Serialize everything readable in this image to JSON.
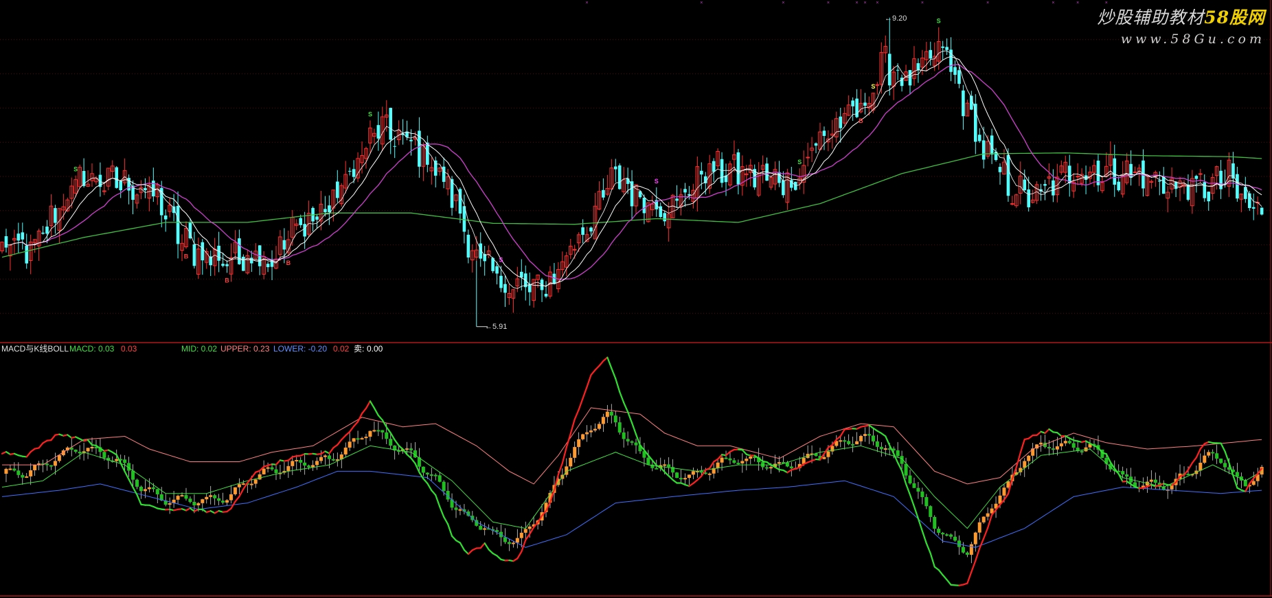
{
  "watermark": {
    "title_a": "炒股辅助教材",
    "title_b": "58股网",
    "url": "www.58Gu.com"
  },
  "indicator": {
    "name": "MACD与K线BOLL",
    "macd_label": "MACD: 0.03",
    "macd_value2": "0.03",
    "mid_label": "MID: 0.02",
    "upper_label": "UPPER: 0.23",
    "lower_label": "LOWER: -0.20",
    "value4": "0.02",
    "sell_label": "卖:",
    "sell_value": "0.00"
  },
  "price_labels": {
    "high": "9.20",
    "low": "5.91"
  },
  "colors": {
    "background": "#000000",
    "up_candle": "#ff3030",
    "down_candle": "#54ffff",
    "ma5": "#ffffff",
    "ma10": "#ffffff",
    "ma20": "#d040d0",
    "ma60": "#40c040",
    "upper_band": "#ff8080",
    "lower_band": "#4070ff",
    "mid_band": "#40e040",
    "macd_line_up": "#ff2020",
    "macd_line_down": "#30e030",
    "bar_up": "#ff9a30",
    "bar_down": "#20c020",
    "divider": "#b01818"
  },
  "markers": {
    "buy": "B",
    "sell": "S"
  },
  "chart_data": [
    {
      "type": "candlestick",
      "panel": "price",
      "price_high": 9.2,
      "price_low": 5.91,
      "anchors": [
        [
          0,
          6.76
        ],
        [
          8,
          6.72
        ],
        [
          14,
          7.2
        ],
        [
          20,
          7.5
        ],
        [
          26,
          7.45
        ],
        [
          32,
          7.42
        ],
        [
          38,
          7.28
        ],
        [
          44,
          6.82
        ],
        [
          50,
          6.66
        ],
        [
          56,
          6.62
        ],
        [
          62,
          6.72
        ],
        [
          66,
          6.62
        ],
        [
          72,
          6.96
        ],
        [
          80,
          7.18
        ],
        [
          86,
          7.6
        ],
        [
          92,
          8.02
        ],
        [
          98,
          7.9
        ],
        [
          104,
          7.72
        ],
        [
          110,
          7.32
        ],
        [
          116,
          6.62
        ],
        [
          122,
          6.38
        ],
        [
          128,
          6.32
        ],
        [
          132,
          6.3
        ],
        [
          136,
          6.52
        ],
        [
          140,
          6.82
        ],
        [
          145,
          7.12
        ],
        [
          150,
          7.52
        ],
        [
          156,
          7.28
        ],
        [
          164,
          7.18
        ],
        [
          172,
          7.58
        ],
        [
          180,
          7.56
        ],
        [
          188,
          7.48
        ],
        [
          194,
          7.48
        ],
        [
          200,
          7.92
        ],
        [
          210,
          8.22
        ],
        [
          216,
          8.72
        ],
        [
          222,
          8.52
        ],
        [
          230,
          8.88
        ],
        [
          234,
          8.42
        ],
        [
          240,
          7.78
        ],
        [
          246,
          7.42
        ],
        [
          252,
          7.26
        ],
        [
          256,
          7.38
        ],
        [
          262,
          7.6
        ],
        [
          268,
          7.56
        ],
        [
          276,
          7.55
        ],
        [
          282,
          7.45
        ],
        [
          288,
          7.4
        ],
        [
          294,
          7.38
        ],
        [
          300,
          7.48
        ],
        [
          304,
          7.2
        ],
        [
          308,
          7.12
        ]
      ],
      "ma60_anchors": [
        [
          0,
          6.65
        ],
        [
          20,
          6.86
        ],
        [
          40,
          7.02
        ],
        [
          60,
          7.02
        ],
        [
          80,
          7.12
        ],
        [
          100,
          7.12
        ],
        [
          120,
          7.01
        ],
        [
          140,
          7.0
        ],
        [
          160,
          7.06
        ],
        [
          180,
          7.02
        ],
        [
          200,
          7.22
        ],
        [
          220,
          7.54
        ],
        [
          240,
          7.75
        ],
        [
          260,
          7.76
        ],
        [
          280,
          7.73
        ],
        [
          300,
          7.72
        ],
        [
          308,
          7.7
        ]
      ]
    },
    {
      "type": "line",
      "panel": "indicator",
      "value_range": [
        -0.38,
        0.36
      ],
      "series": [
        {
          "name": "MACD",
          "anchors": [
            [
              0,
              0.06
            ],
            [
              6,
              0.05
            ],
            [
              14,
              0.12
            ],
            [
              20,
              0.1
            ],
            [
              28,
              0.05
            ],
            [
              34,
              -0.1
            ],
            [
              40,
              -0.12
            ],
            [
              46,
              -0.12
            ],
            [
              52,
              -0.13
            ],
            [
              56,
              -0.12
            ],
            [
              62,
              0.0
            ],
            [
              68,
              0.03
            ],
            [
              74,
              0.05
            ],
            [
              80,
              0.06
            ],
            [
              86,
              0.14
            ],
            [
              90,
              0.22
            ],
            [
              96,
              0.1
            ],
            [
              100,
              0.04
            ],
            [
              106,
              -0.08
            ],
            [
              110,
              -0.2
            ],
            [
              114,
              -0.26
            ],
            [
              118,
              -0.23
            ],
            [
              122,
              -0.28
            ],
            [
              126,
              -0.28
            ],
            [
              128,
              -0.22
            ],
            [
              134,
              -0.1
            ],
            [
              140,
              0.16
            ],
            [
              144,
              0.3
            ],
            [
              148,
              0.36
            ],
            [
              152,
              0.22
            ],
            [
              156,
              0.08
            ],
            [
              160,
              0.02
            ],
            [
              164,
              -0.03
            ],
            [
              168,
              -0.05
            ],
            [
              172,
              0.0
            ],
            [
              176,
              0.05
            ],
            [
              180,
              0.07
            ],
            [
              188,
              0.02
            ],
            [
              192,
              0.0
            ],
            [
              196,
              0.02
            ],
            [
              200,
              0.04
            ],
            [
              206,
              0.13
            ],
            [
              212,
              0.14
            ],
            [
              216,
              0.11
            ],
            [
              220,
              0.0
            ],
            [
              224,
              -0.15
            ],
            [
              228,
              -0.3
            ],
            [
              232,
              -0.36
            ],
            [
              236,
              -0.35
            ],
            [
              242,
              -0.14
            ],
            [
              246,
              -0.07
            ],
            [
              250,
              0.1
            ],
            [
              256,
              0.13
            ],
            [
              262,
              0.1
            ],
            [
              266,
              0.09
            ],
            [
              270,
              0.05
            ],
            [
              274,
              -0.03
            ],
            [
              278,
              -0.05
            ],
            [
              286,
              -0.04
            ],
            [
              290,
              0.0
            ],
            [
              294,
              0.09
            ],
            [
              298,
              0.09
            ],
            [
              300,
              0.03
            ],
            [
              302,
              -0.05
            ],
            [
              304,
              -0.06
            ],
            [
              308,
              0.01
            ]
          ]
        },
        {
          "name": "UPPER",
          "anchors": [
            [
              0,
              0.02
            ],
            [
              10,
              0.02
            ],
            [
              20,
              0.1
            ],
            [
              30,
              0.11
            ],
            [
              36,
              0.07
            ],
            [
              46,
              0.03
            ],
            [
              58,
              0.03
            ],
            [
              66,
              0.06
            ],
            [
              76,
              0.08
            ],
            [
              88,
              0.17
            ],
            [
              98,
              0.14
            ],
            [
              106,
              0.15
            ],
            [
              116,
              0.08
            ],
            [
              124,
              0.0
            ],
            [
              130,
              -0.04
            ],
            [
              136,
              0.05
            ],
            [
              144,
              0.2
            ],
            [
              156,
              0.18
            ],
            [
              162,
              0.12
            ],
            [
              170,
              0.08
            ],
            [
              178,
              0.08
            ],
            [
              190,
              0.04
            ],
            [
              200,
              0.11
            ],
            [
              210,
              0.15
            ],
            [
              218,
              0.14
            ],
            [
              228,
              0.0
            ],
            [
              236,
              -0.04
            ],
            [
              244,
              -0.02
            ],
            [
              252,
              0.07
            ],
            [
              262,
              0.12
            ],
            [
              270,
              0.09
            ],
            [
              280,
              0.07
            ],
            [
              292,
              0.08
            ],
            [
              300,
              0.09
            ],
            [
              308,
              0.1
            ]
          ]
        },
        {
          "name": "MID",
          "anchors": [
            [
              0,
              -0.05
            ],
            [
              10,
              -0.03
            ],
            [
              20,
              0.06
            ],
            [
              30,
              0.02
            ],
            [
              40,
              -0.07
            ],
            [
              50,
              -0.07
            ],
            [
              60,
              -0.03
            ],
            [
              70,
              0.0
            ],
            [
              80,
              0.02
            ],
            [
              90,
              0.08
            ],
            [
              100,
              0.06
            ],
            [
              110,
              -0.03
            ],
            [
              120,
              -0.16
            ],
            [
              128,
              -0.18
            ],
            [
              138,
              0.0
            ],
            [
              150,
              0.06
            ],
            [
              158,
              0.02
            ],
            [
              170,
              0.0
            ],
            [
              180,
              0.02
            ],
            [
              190,
              0.02
            ],
            [
              200,
              0.06
            ],
            [
              210,
              0.08
            ],
            [
              220,
              0.04
            ],
            [
              228,
              -0.08
            ],
            [
              236,
              -0.18
            ],
            [
              244,
              -0.05
            ],
            [
              254,
              0.05
            ],
            [
              266,
              0.07
            ],
            [
              274,
              -0.02
            ],
            [
              284,
              -0.05
            ],
            [
              296,
              0.02
            ],
            [
              304,
              -0.03
            ],
            [
              308,
              0.0
            ]
          ]
        },
        {
          "name": "LOWER",
          "anchors": [
            [
              0,
              -0.08
            ],
            [
              14,
              -0.06
            ],
            [
              24,
              -0.04
            ],
            [
              36,
              -0.08
            ],
            [
              48,
              -0.12
            ],
            [
              60,
              -0.1
            ],
            [
              72,
              -0.05
            ],
            [
              82,
              0.0
            ],
            [
              90,
              0.0
            ],
            [
              104,
              -0.02
            ],
            [
              116,
              -0.16
            ],
            [
              128,
              -0.24
            ],
            [
              138,
              -0.2
            ],
            [
              150,
              -0.1
            ],
            [
              164,
              -0.08
            ],
            [
              180,
              -0.06
            ],
            [
              192,
              -0.05
            ],
            [
              206,
              -0.03
            ],
            [
              218,
              -0.08
            ],
            [
              230,
              -0.22
            ],
            [
              238,
              -0.24
            ],
            [
              250,
              -0.18
            ],
            [
              262,
              -0.08
            ],
            [
              274,
              -0.05
            ],
            [
              286,
              -0.06
            ],
            [
              298,
              -0.07
            ],
            [
              308,
              -0.06
            ]
          ]
        }
      ]
    }
  ]
}
